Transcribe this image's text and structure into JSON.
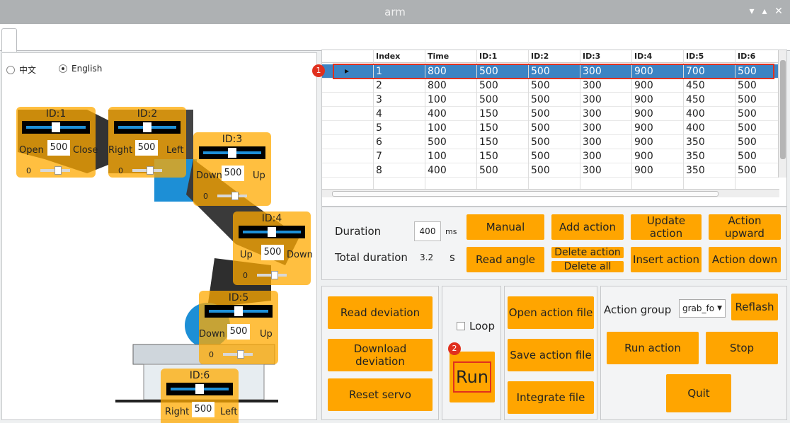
{
  "window": {
    "title": "arm",
    "controls": {
      "minimize": "▾",
      "restore": "▴",
      "close": "✕"
    }
  },
  "language": {
    "options": [
      "中文",
      "English"
    ],
    "selected": "English"
  },
  "servos": [
    {
      "id": "ID:1",
      "left_label": "Open",
      "right_label": "Close",
      "value": "500",
      "min": "0"
    },
    {
      "id": "ID:2",
      "left_label": "Right",
      "right_label": "Left",
      "value": "500",
      "min": "0"
    },
    {
      "id": "ID:3",
      "left_label": "Down",
      "right_label": "Up",
      "value": "500",
      "min": "0"
    },
    {
      "id": "ID:4",
      "left_label": "Up",
      "right_label": "Down",
      "value": "500",
      "min": "0"
    },
    {
      "id": "ID:5",
      "left_label": "Down",
      "right_label": "Up",
      "value": "500",
      "min": "0"
    },
    {
      "id": "ID:6",
      "left_label": "Right",
      "right_label": "Left",
      "value": "500",
      "min": "0"
    }
  ],
  "table": {
    "columns": [
      "Index",
      "Time",
      "ID:1",
      "ID:2",
      "ID:3",
      "ID:4",
      "ID:5",
      "ID:6"
    ],
    "rows": [
      [
        "1",
        "800",
        "500",
        "500",
        "300",
        "900",
        "700",
        "500"
      ],
      [
        "2",
        "800",
        "500",
        "500",
        "300",
        "900",
        "450",
        "500"
      ],
      [
        "3",
        "100",
        "500",
        "500",
        "300",
        "900",
        "450",
        "500"
      ],
      [
        "4",
        "400",
        "150",
        "500",
        "300",
        "900",
        "400",
        "500"
      ],
      [
        "5",
        "100",
        "150",
        "500",
        "300",
        "900",
        "400",
        "500"
      ],
      [
        "6",
        "500",
        "150",
        "500",
        "300",
        "900",
        "350",
        "500"
      ],
      [
        "7",
        "100",
        "150",
        "500",
        "300",
        "900",
        "350",
        "500"
      ],
      [
        "8",
        "400",
        "500",
        "500",
        "300",
        "900",
        "350",
        "500"
      ]
    ],
    "selected_row": "1",
    "row_marker": "▸"
  },
  "markers": {
    "m1": "1",
    "m2": "2"
  },
  "controls": {
    "duration_label": "Duration",
    "duration_value": "400",
    "duration_unit": "ms",
    "total_label": "Total duration",
    "total_value": "3.2",
    "total_unit": "s",
    "manual": "Manual",
    "add_action": "Add action",
    "update_action": "Update action",
    "action_upward": "Action upward",
    "read_angle": "Read angle",
    "delete_action": "Delete action",
    "delete_all": "Delete all",
    "insert_action": "Insert action",
    "action_down": "Action down"
  },
  "deviation": {
    "read": "Read deviation",
    "download": "Download deviation",
    "reset": "Reset servo"
  },
  "run": {
    "loop_label": "Loop",
    "run_label": "Run"
  },
  "files": {
    "open": "Open action file",
    "save": "Save action file",
    "integrate": "Integrate file"
  },
  "group": {
    "label": "Action group",
    "selected": "grab_fo",
    "reflash": "Reflash",
    "run_action": "Run action",
    "stop": "Stop",
    "quit": "Quit"
  }
}
